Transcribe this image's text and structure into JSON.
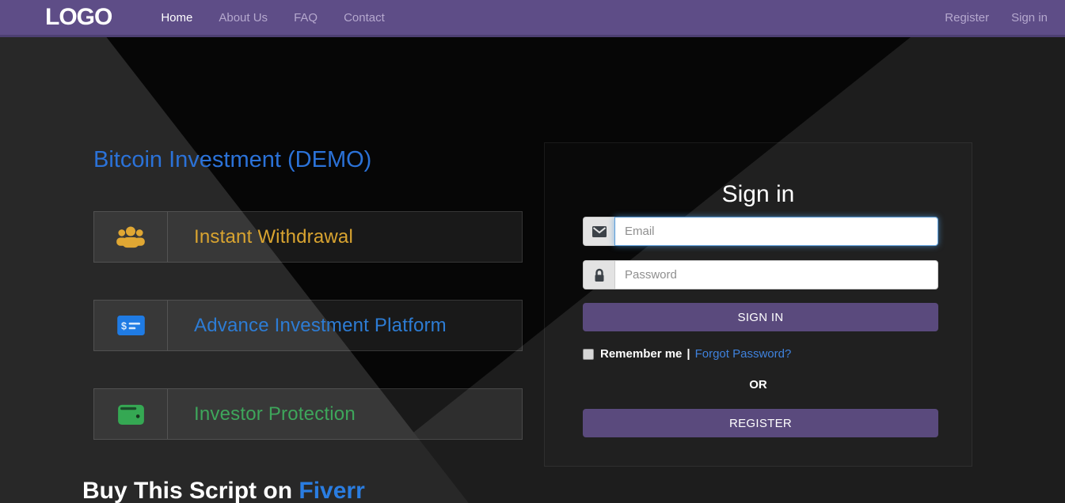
{
  "navbar": {
    "brand": "LOGO",
    "links": [
      {
        "label": "Home",
        "active": true
      },
      {
        "label": "About Us",
        "active": false
      },
      {
        "label": "FAQ",
        "active": false
      },
      {
        "label": "Contact",
        "active": false
      }
    ],
    "right_links": [
      {
        "label": "Register"
      },
      {
        "label": "Sign in"
      }
    ]
  },
  "hero": {
    "title": "Bitcoin Investment (DEMO)"
  },
  "features": [
    {
      "label": "Instant Withdrawal",
      "icon": "users-icon",
      "color": "#d9a430"
    },
    {
      "label": "Advance Investment Platform",
      "icon": "money-check-icon",
      "color": "#2d7cd4"
    },
    {
      "label": "Investor Protection",
      "icon": "wallet-icon",
      "color": "#3ea65b"
    }
  ],
  "signin": {
    "title": "Sign in",
    "email_placeholder": "Email",
    "password_placeholder": "Password",
    "signin_button": "SIGN IN",
    "remember_label": "Remember me",
    "separator": "|",
    "forgot_link": "Forgot Password?",
    "or_label": "OR",
    "register_button": "REGISTER",
    "remember_checked": false
  },
  "footer": {
    "text": "Buy This Script on",
    "link": "Fiverr"
  },
  "colors": {
    "navbar_purple": "#5e4d87",
    "button_purple": "#5a4a7d",
    "hero_title_blue": "#2b72d8",
    "forgot_link_blue": "#3f82dd",
    "fiverr_blue": "#2a7de1",
    "feature_gold": "#d9a430",
    "feature_blue": "#2d7cd4",
    "feature_green": "#3ea65b",
    "focus_ring_blue": "#5b9dd9"
  }
}
